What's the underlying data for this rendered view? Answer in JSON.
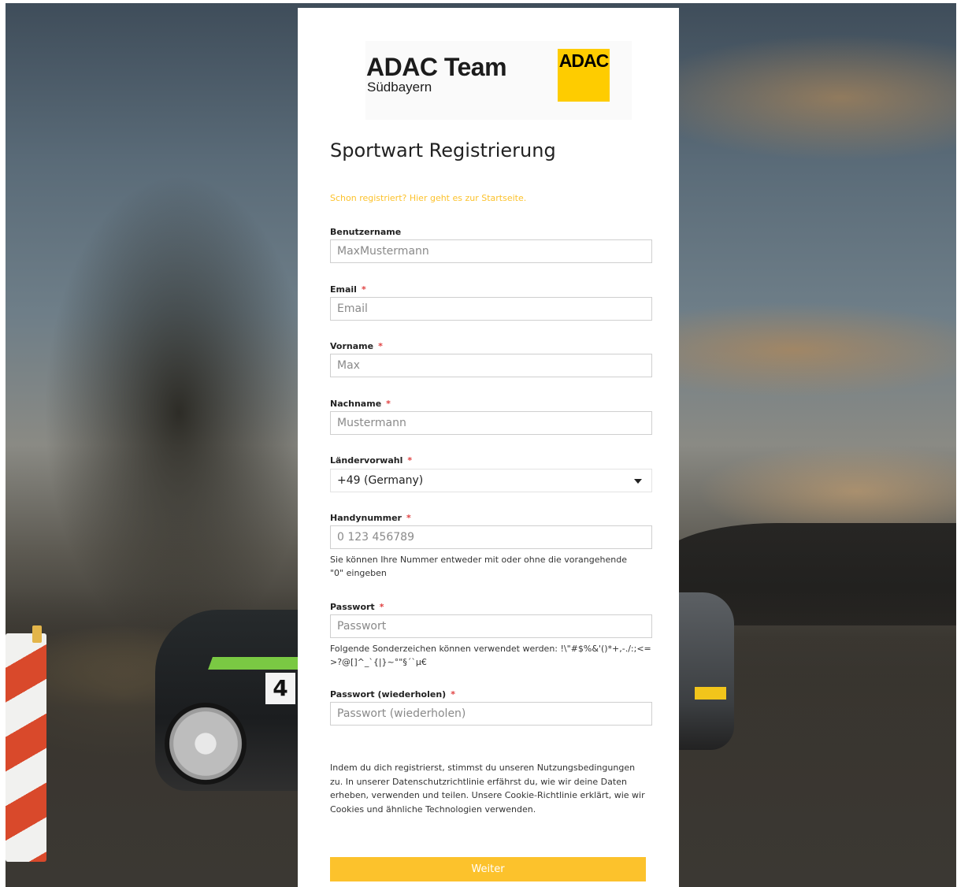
{
  "brand": {
    "title": "ADAC Team",
    "subtitle": "Südbayern",
    "badge": "ADAC",
    "badge_color": "#fecc00"
  },
  "page_title": "Sportwart Registrierung",
  "login_link": "Schon registriert? Hier geht es zur Startseite.",
  "required_marker": "*",
  "fields": {
    "username": {
      "label": "Benutzername",
      "placeholder": "MaxMustermann",
      "value": ""
    },
    "email": {
      "label": "Email",
      "placeholder": "Email",
      "value": ""
    },
    "firstname": {
      "label": "Vorname",
      "placeholder": "Max",
      "value": ""
    },
    "lastname": {
      "label": "Nachname",
      "placeholder": "Mustermann",
      "value": ""
    },
    "country_code": {
      "label": "Ländervorwahl",
      "selected": "+49 (Germany)"
    },
    "phone": {
      "label": "Handynummer",
      "placeholder": "0 123 456789",
      "value": "",
      "hint": "Sie können Ihre Nummer entweder mit oder ohne die vorangehende \"0\" eingeben"
    },
    "password": {
      "label": "Passwort",
      "placeholder": "Passwort",
      "value": "",
      "hint": "Folgende Sonderzeichen können verwendet werden: !\\\"#$%&'()*+,-./:;<=>?@[]^_`{|}~°\"§´`µ€"
    },
    "password_repeat": {
      "label": "Passwort (wiederholen)",
      "placeholder": "Passwort (wiederholen)",
      "value": ""
    }
  },
  "terms": "Indem du dich registrierst, stimmst du unseren Nutzungsbedingungen zu. In unserer Datenschutzrichtlinie erfährst du, wie wir deine Daten erheben, verwenden und teilen. Unsere Cookie-Richtlinie erklärt, wie wir Cookies und ähnliche Technologien verwenden.",
  "submit_label": "Weiter",
  "colors": {
    "accent": "#fcc22c",
    "required": "#e04141"
  },
  "icons": {
    "select_caret": "chevron-down-icon"
  }
}
